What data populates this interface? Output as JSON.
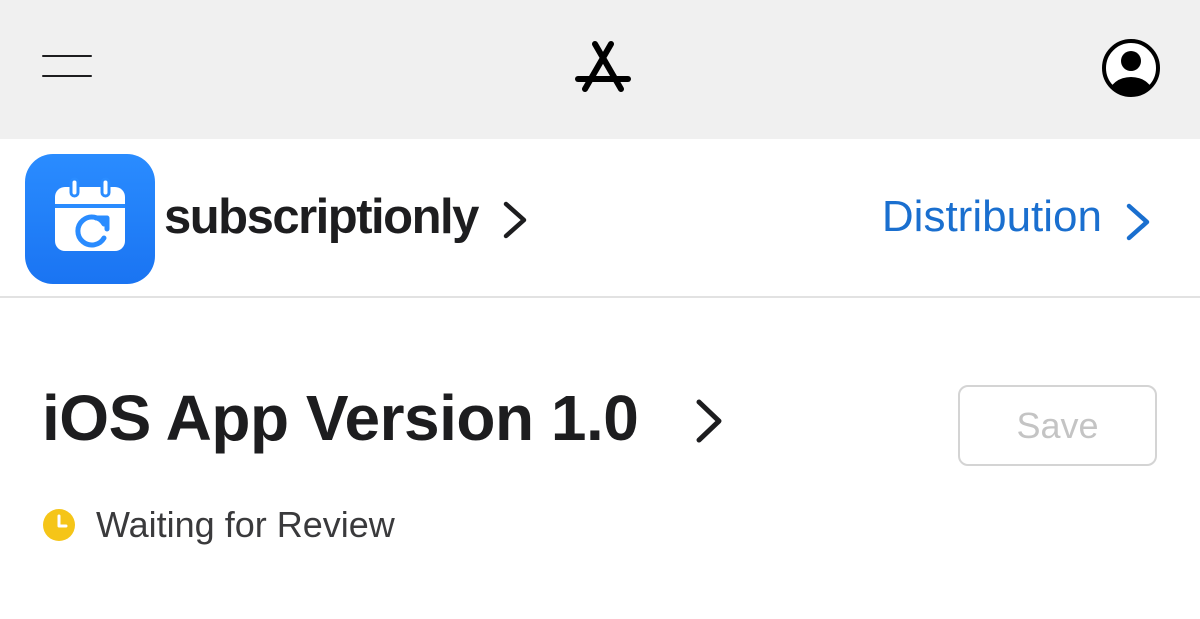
{
  "topbar": {
    "menu_icon": "hamburger-menu-icon",
    "logo_icon": "app-store-icon",
    "account_icon": "account-circle-icon"
  },
  "app": {
    "name": "subscriptionly",
    "icon": "calendar-refresh-icon",
    "icon_color": "#1a74f2",
    "distribution_label": "Distribution",
    "link_color": "#1a6fcf"
  },
  "version": {
    "title": "iOS App Version 1.0",
    "save_label": "Save"
  },
  "status": {
    "text": "Waiting for Review",
    "icon": "clock-icon",
    "color": "#f5c518"
  }
}
